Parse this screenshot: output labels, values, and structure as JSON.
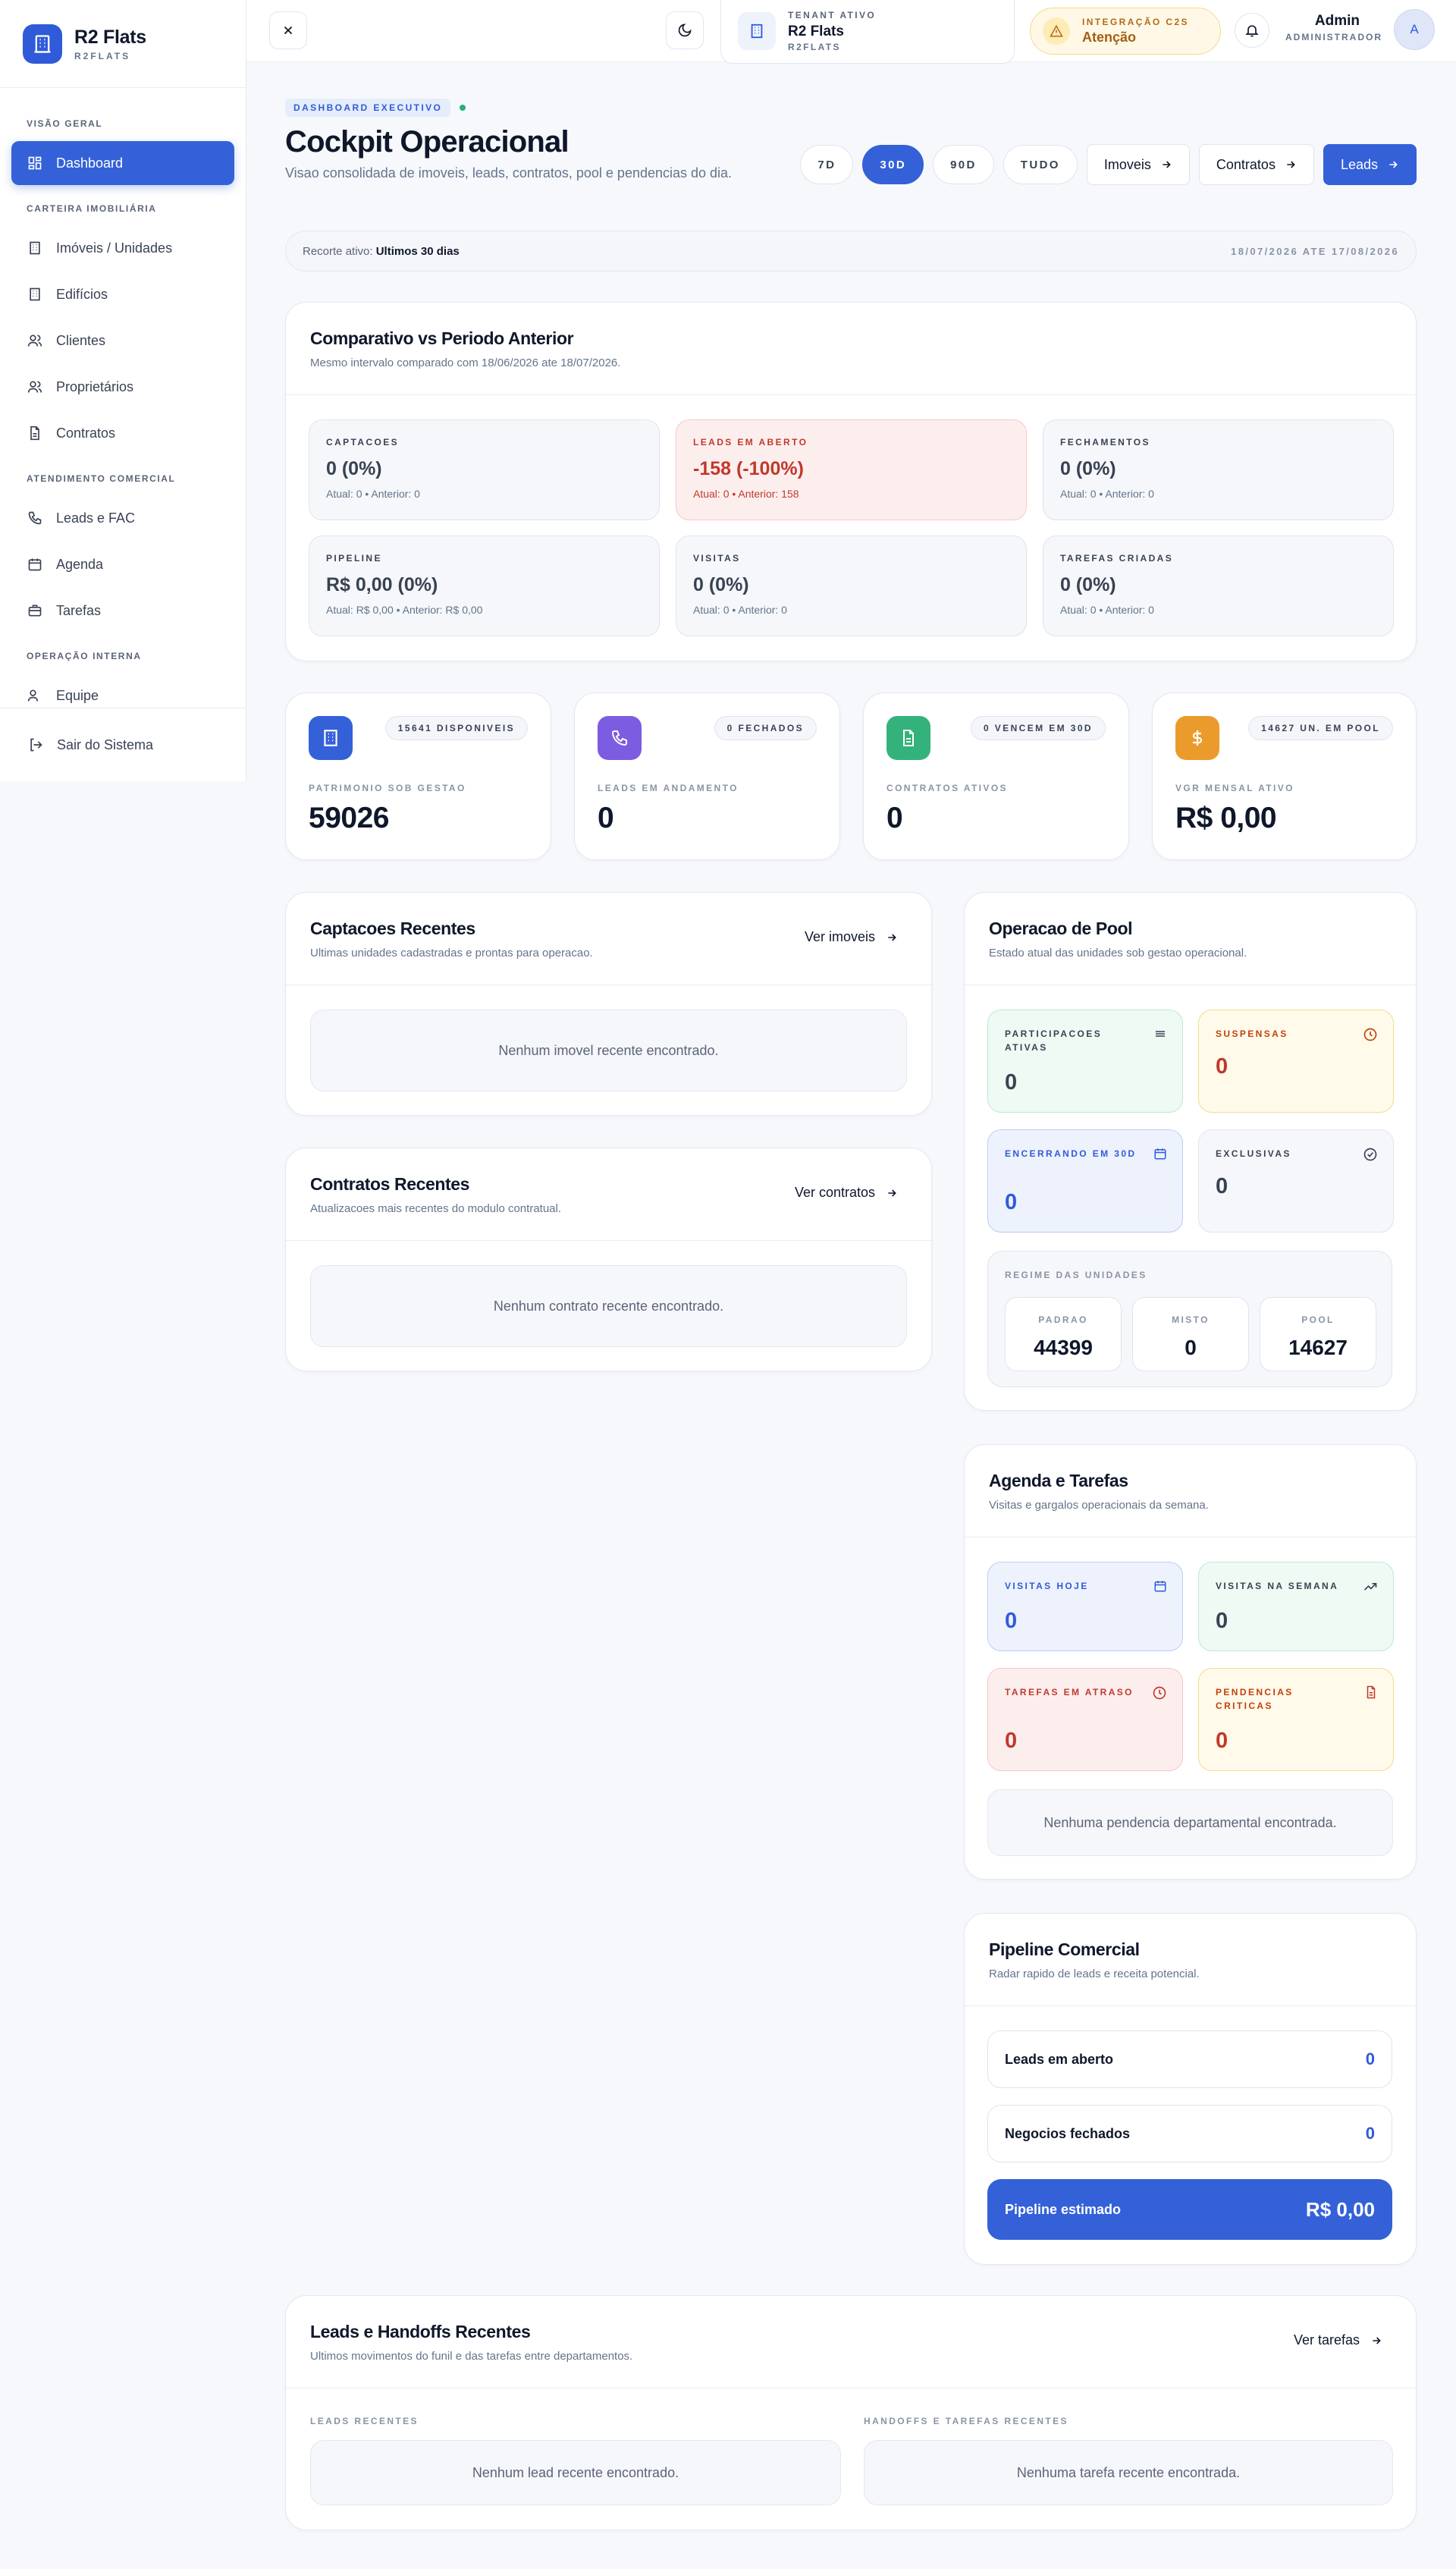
{
  "app": {
    "name": "R2 Flats",
    "sub": "R2FLATS"
  },
  "sidebar": {
    "sections": [
      "VISÃO GERAL",
      "CARTEIRA IMOBILIÁRIA",
      "ATENDIMENTO COMERCIAL",
      "OPERAÇÃO INTERNA"
    ],
    "items": [
      {
        "label": "Dashboard",
        "icon": "grid-icon",
        "active": true
      },
      {
        "label": "Imóveis / Unidades",
        "icon": "building-icon"
      },
      {
        "label": "Edifícios",
        "icon": "building-icon"
      },
      {
        "label": "Clientes",
        "icon": "users-icon"
      },
      {
        "label": "Proprietários",
        "icon": "users-icon"
      },
      {
        "label": "Contratos",
        "icon": "document-icon"
      },
      {
        "label": "Leads e FAC",
        "icon": "phone-icon"
      },
      {
        "label": "Agenda",
        "icon": "calendar-icon"
      },
      {
        "label": "Tarefas",
        "icon": "briefcase-icon"
      },
      {
        "label": "Equipe",
        "icon": "users-icon"
      }
    ],
    "logout": "Sair do Sistema"
  },
  "topbar": {
    "tenant_label": "TENANT ATIVO",
    "tenant_name": "R2 Flats",
    "tenant_sub": "R2FLATS",
    "integration_label": "INTEGRAÇÃO C2S",
    "integration_status": "Atenção",
    "user_name": "Admin",
    "user_role": "ADMINISTRADOR",
    "avatar_initial": "A"
  },
  "header": {
    "eyebrow": "DASHBOARD EXECUTIVO",
    "title": "Cockpit Operacional",
    "subtitle": "Visao consolidada de imoveis, leads, contratos, pool e pendencias do dia.",
    "ranges": [
      "7D",
      "30D",
      "90D",
      "TUDO"
    ],
    "active_range": "30D",
    "links": [
      "Imoveis",
      "Contratos",
      "Leads"
    ]
  },
  "recorte": {
    "label": "Recorte ativo:",
    "value": "Ultimos 30 dias",
    "dates": "18/07/2026 ATE 17/08/2026"
  },
  "comparativo": {
    "title": "Comparativo vs Periodo Anterior",
    "subtitle": "Mesmo intervalo comparado com 18/06/2026 ate 18/07/2026.",
    "items": [
      {
        "label": "CAPTACOES",
        "value": "0 (0%)",
        "meta": "Atual: 0 • Anterior: 0"
      },
      {
        "label": "LEADS EM ABERTO",
        "value": "-158 (-100%)",
        "meta": "Atual: 0 • Anterior: 158",
        "alert": true
      },
      {
        "label": "FECHAMENTOS",
        "value": "0 (0%)",
        "meta": "Atual: 0 • Anterior: 0"
      },
      {
        "label": "PIPELINE",
        "value": "R$ 0,00 (0%)",
        "meta": "Atual: R$ 0,00 • Anterior: R$ 0,00"
      },
      {
        "label": "VISITAS",
        "value": "0 (0%)",
        "meta": "Atual: 0 • Anterior: 0"
      },
      {
        "label": "TAREFAS CRIADAS",
        "value": "0 (0%)",
        "meta": "Atual: 0 • Anterior: 0"
      }
    ]
  },
  "kpis": [
    {
      "badge": "15641 DISPONIVEIS",
      "label": "PATRIMONIO SOB GESTAO",
      "value": "59026",
      "icon": "building-icon",
      "color": "#3461d8"
    },
    {
      "badge": "0 FECHADOS",
      "label": "LEADS EM ANDAMENTO",
      "value": "0",
      "icon": "phone-icon",
      "color": "#7c5ce0"
    },
    {
      "badge": "0 VENCEM EM 30D",
      "label": "CONTRATOS ATIVOS",
      "value": "0",
      "icon": "document-icon",
      "color": "#34b27b"
    },
    {
      "badge": "14627 UN. EM POOL",
      "label": "VGR MENSAL ATIVO",
      "value": "R$ 0,00",
      "icon": "dollar-icon",
      "color": "#eb9b2b"
    }
  ],
  "captacoes": {
    "title": "Captacoes Recentes",
    "subtitle": "Ultimas unidades cadastradas e prontas para operacao.",
    "link": "Ver imoveis",
    "empty": "Nenhum imovel recente encontrado."
  },
  "contratos": {
    "title": "Contratos Recentes",
    "subtitle": "Atualizacoes mais recentes do modulo contratual.",
    "link": "Ver contratos",
    "empty": "Nenhum contrato recente encontrado."
  },
  "pool": {
    "title": "Operacao de Pool",
    "subtitle": "Estado atual das unidades sob gestao operacional.",
    "tiles": [
      {
        "label": "PARTICIPACOES ATIVAS",
        "value": "0"
      },
      {
        "label": "SUSPENSAS",
        "value": "0"
      },
      {
        "label": "ENCERRANDO EM 30D",
        "value": "0"
      },
      {
        "label": "EXCLUSIVAS",
        "value": "0"
      }
    ],
    "regime_label": "REGIME DAS UNIDADES",
    "regime": [
      {
        "label": "PADRAO",
        "value": "44399"
      },
      {
        "label": "MISTO",
        "value": "0"
      },
      {
        "label": "POOL",
        "value": "14627"
      }
    ]
  },
  "agenda": {
    "title": "Agenda e Tarefas",
    "subtitle": "Visitas e gargalos operacionais da semana.",
    "tiles": [
      {
        "label": "VISITAS HOJE",
        "value": "0"
      },
      {
        "label": "VISITAS NA SEMANA",
        "value": "0"
      },
      {
        "label": "TAREFAS EM ATRASO",
        "value": "0"
      },
      {
        "label": "PENDENCIAS CRITICAS",
        "value": "0"
      }
    ],
    "empty": "Nenhuma pendencia departamental encontrada."
  },
  "pipeline": {
    "title": "Pipeline Comercial",
    "subtitle": "Radar rapido de leads e receita potencial.",
    "rows": [
      {
        "label": "Leads em aberto",
        "value": "0"
      },
      {
        "label": "Negocios fechados",
        "value": "0"
      },
      {
        "label": "Pipeline estimado",
        "value": "R$ 0,00"
      }
    ]
  },
  "leads_handoffs": {
    "title": "Leads e Handoffs Recentes",
    "subtitle": "Ultimos movimentos do funil e das tarefas entre departamentos.",
    "link": "Ver tarefas",
    "left_label": "LEADS RECENTES",
    "right_label": "HANDOFFS E TAREFAS RECENTES",
    "left_empty": "Nenhum lead recente encontrado.",
    "right_empty": "Nenhuma tarefa recente encontrada."
  }
}
